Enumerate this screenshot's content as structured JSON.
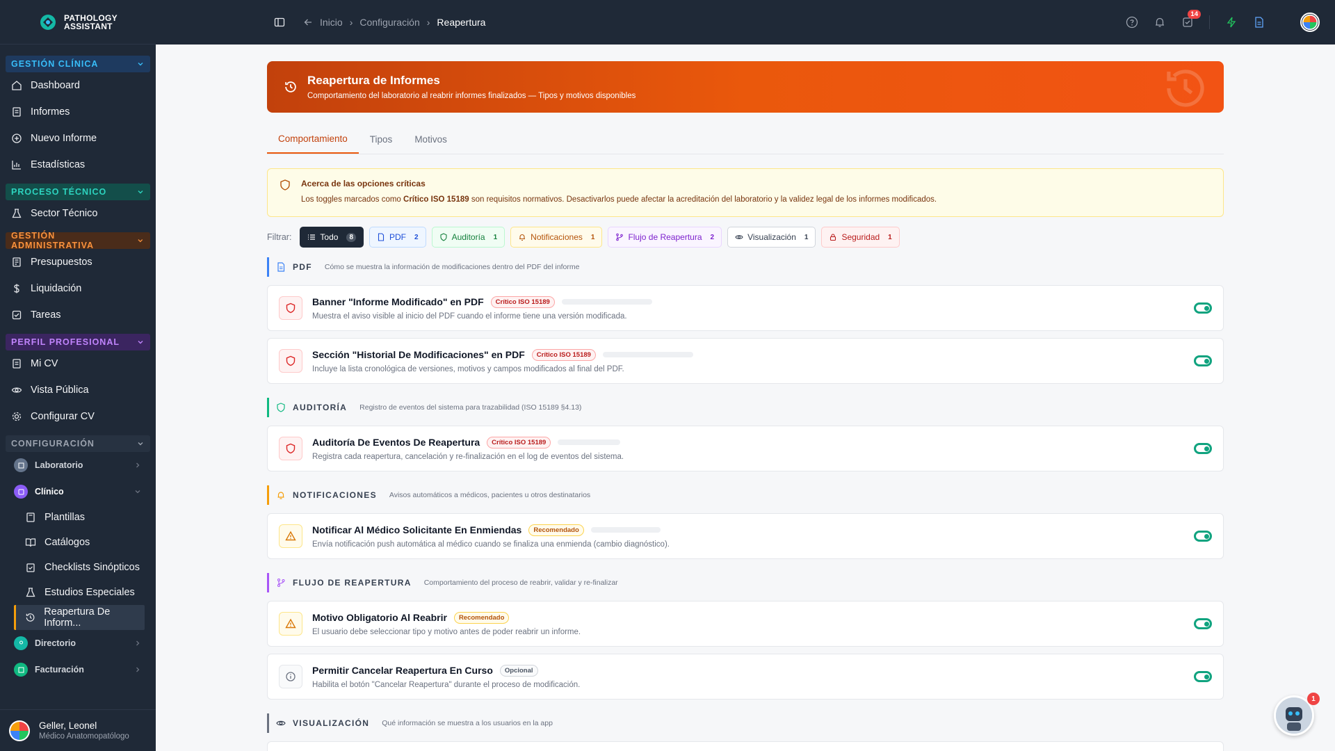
{
  "brand": {
    "line1": "PATHOLOGY",
    "line2": "ASSISTANT"
  },
  "sidebar": {
    "sections": [
      {
        "title": "GESTIÓN CLÍNICA",
        "items": [
          "Dashboard",
          "Informes",
          "Nuevo Informe",
          "Estadísticas"
        ]
      },
      {
        "title": "PROCESO TÉCNICO",
        "items": [
          "Sector Técnico"
        ]
      },
      {
        "title": "GESTIÓN ADMINISTRATIVA",
        "items": [
          "Presupuestos",
          "Liquidación",
          "Tareas"
        ]
      },
      {
        "title": "PERFIL PROFESIONAL",
        "items": [
          "Mi CV",
          "Vista Pública",
          "Configurar CV"
        ]
      },
      {
        "title": "CONFIGURACIÓN"
      }
    ],
    "config": {
      "laboratorio": "Laboratorio",
      "clinico": "Clínico",
      "clinico_items": [
        "Plantillas",
        "Catálogos",
        "Checklists Sinópticos",
        "Estudios Especiales",
        "Reapertura De Inform..."
      ],
      "directorio": "Directorio",
      "facturacion": "Facturación"
    },
    "user": {
      "name": "Geller, Leonel",
      "role": "Médico Anatomopatólogo"
    }
  },
  "topbar": {
    "breadcrumbs": [
      "Inicio",
      "Configuración",
      "Reapertura"
    ],
    "tasks_badge": "14"
  },
  "hero": {
    "title": "Reapertura de Informes",
    "subtitle": "Comportamiento del laboratorio al reabrir informes finalizados — Tipos y motivos disponibles"
  },
  "tabs": [
    "Comportamiento",
    "Tipos",
    "Motivos"
  ],
  "alert": {
    "title": "Acerca de las opciones críticas",
    "text_before": "Los toggles marcados como ",
    "text_bold": "Crítico ISO 15189",
    "text_after": " son requisitos normativos. Desactivarlos puede afectar la acreditación del laboratorio y la validez legal de los informes modificados."
  },
  "filters": {
    "label": "Filtrar:",
    "chips": [
      {
        "label": "Todo",
        "count": "8"
      },
      {
        "label": "PDF",
        "count": "2"
      },
      {
        "label": "Auditoría",
        "count": "1"
      },
      {
        "label": "Notificaciones",
        "count": "1"
      },
      {
        "label": "Flujo de Reapertura",
        "count": "2"
      },
      {
        "label": "Visualización",
        "count": "1"
      },
      {
        "label": "Seguridad",
        "count": "1"
      }
    ]
  },
  "groups": [
    {
      "title": "PDF",
      "desc": "Cómo se muestra la información de modificaciones dentro del PDF del informe",
      "cards": [
        {
          "title": "Banner \"Informe Modificado\" en PDF",
          "tag": "Crítico ISO 15189",
          "desc": "Muestra el aviso visible al inicio del PDF cuando el informe tiene una versión modificada."
        },
        {
          "title": "Sección \"Historial De Modificaciones\" en PDF",
          "tag": "Crítico ISO 15189",
          "desc": "Incluye la lista cronológica de versiones, motivos y campos modificados al final del PDF."
        }
      ]
    },
    {
      "title": "AUDITORÍA",
      "desc": "Registro de eventos del sistema para trazabilidad (ISO 15189 §4.13)",
      "cards": [
        {
          "title": "Auditoría De Eventos De Reapertura",
          "tag": "Crítico ISO 15189",
          "desc": "Registra cada reapertura, cancelación y re-finalización en el log de eventos del sistema."
        }
      ]
    },
    {
      "title": "NOTIFICACIONES",
      "desc": "Avisos automáticos a médicos, pacientes u otros destinatarios",
      "cards": [
        {
          "title": "Notificar Al Médico Solicitante En Enmiendas",
          "tag": "Recomendado",
          "desc": "Envía notificación push automática al médico cuando se finaliza una enmienda (cambio diagnóstico)."
        }
      ]
    },
    {
      "title": "FLUJO DE REAPERTURA",
      "desc": "Comportamiento del proceso de reabrir, validar y re-finalizar",
      "cards": [
        {
          "title": "Motivo Obligatorio Al Reabrir",
          "tag": "Recomendado",
          "desc": "El usuario debe seleccionar tipo y motivo antes de poder reabrir un informe."
        },
        {
          "title": "Permitir Cancelar Reapertura En Curso",
          "tag": "Opcional",
          "desc": "Habilita el botón \"Cancelar Reapertura\" durante el proceso de modificación."
        }
      ]
    },
    {
      "title": "VISUALIZACIÓN",
      "desc": "Qué información se muestra a los usuarios en la app"
    }
  ],
  "assistant_badge": "1",
  "colors": {
    "accent": "#ea580c",
    "toggle_on": "#10a37f",
    "sidebar_bg": "#1f2937"
  }
}
